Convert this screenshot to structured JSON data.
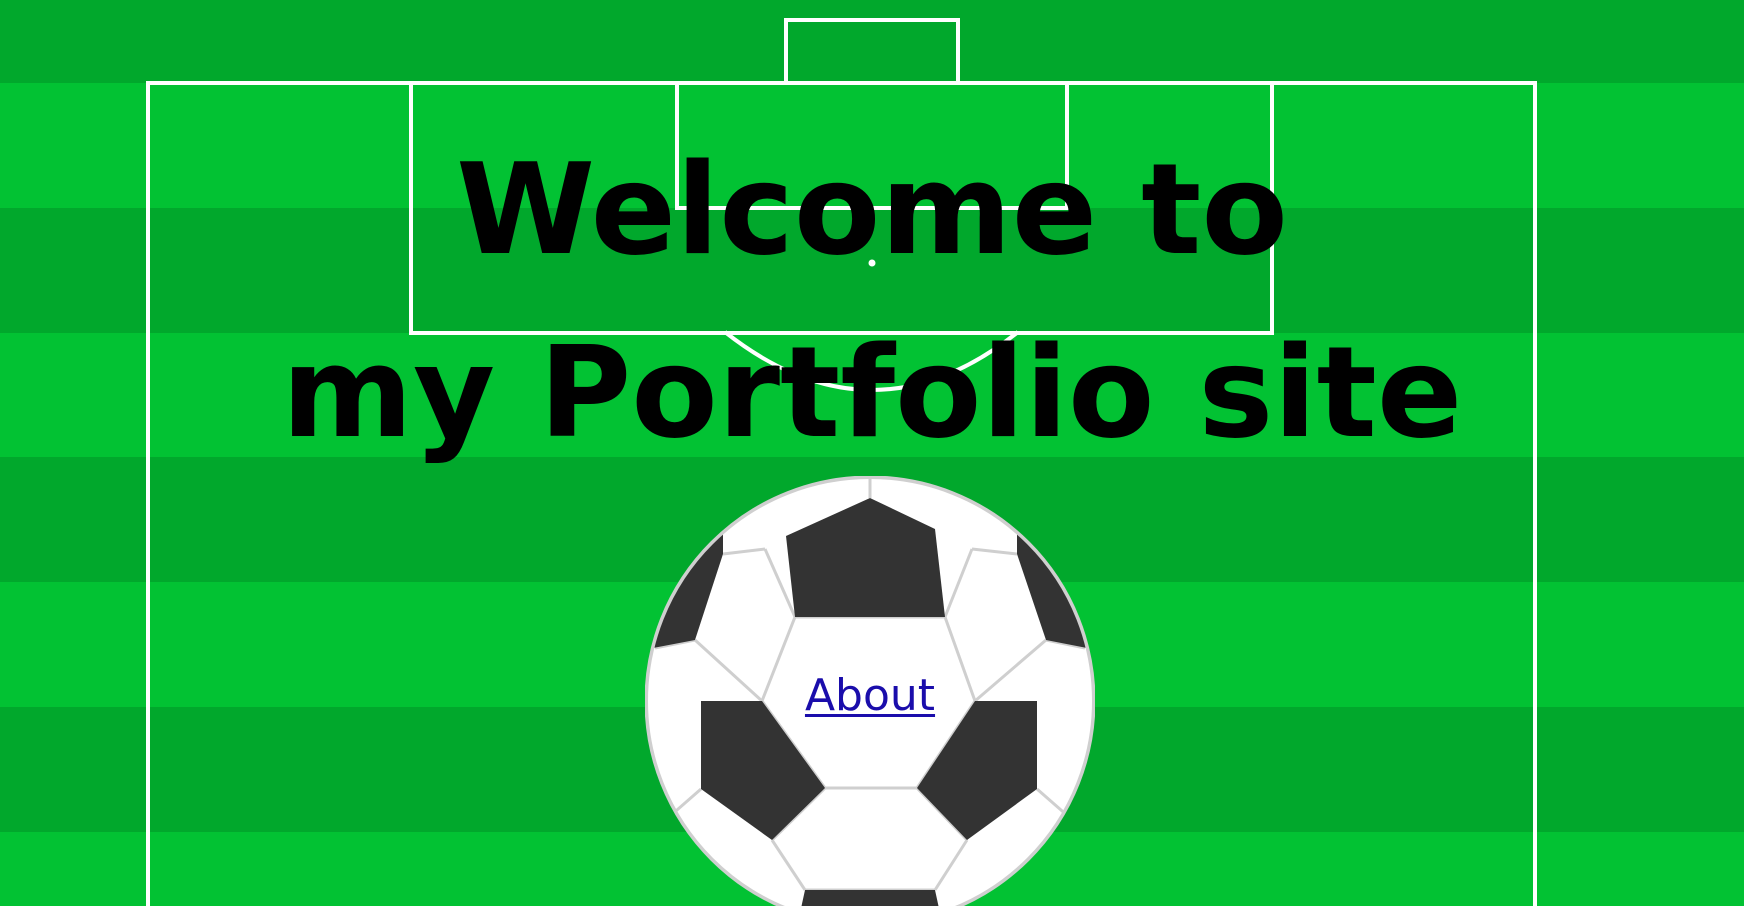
{
  "hero": {
    "line1": "Welcome to",
    "line2": "my Portfolio site"
  },
  "nav": {
    "about_label": "About"
  },
  "colors": {
    "grass_light": "#02c233",
    "grass_dark": "#01a82c",
    "line": "#ffffff",
    "ball_patch": "#333333",
    "ball_white": "#ffffff",
    "ball_seam": "#cfcfcf",
    "link": "#1a0dab"
  },
  "icons": {
    "pitch": "soccer-pitch-background",
    "ball": "soccer-ball-icon"
  }
}
